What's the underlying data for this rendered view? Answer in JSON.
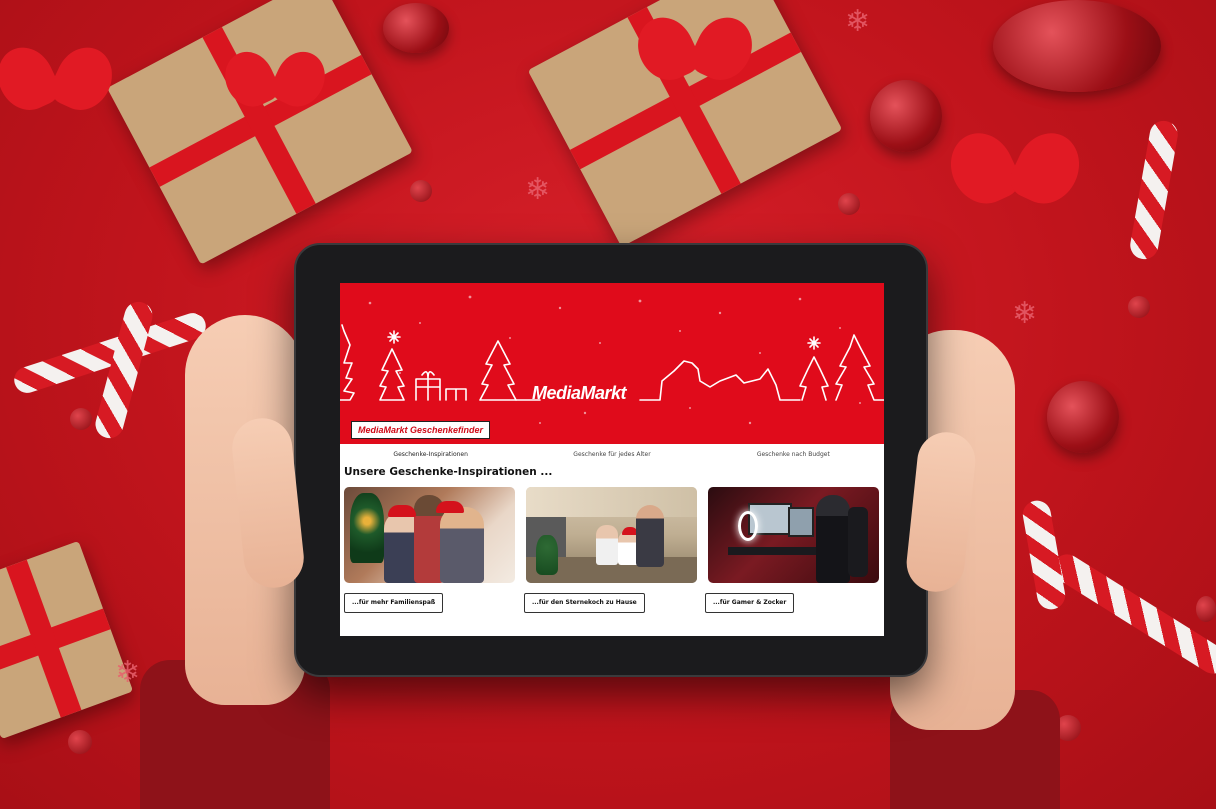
{
  "app": {
    "brand_logo": "MediaMarkt",
    "banner_badge": "MediaMarkt Geschenkefinder"
  },
  "tabs": [
    {
      "label": "Geschenke-Inspirationen",
      "active": true
    },
    {
      "label": "Geschenke für jedes Alter",
      "active": false
    },
    {
      "label": "Geschenke nach Budget",
      "active": false
    }
  ],
  "section": {
    "title": "Unsere Geschenke-Inspirationen ..."
  },
  "cards": [
    {
      "button_label": "...für mehr Familienspaß",
      "image_icon": "family-photo-icon"
    },
    {
      "button_label": "...für den Sternekoch zu Hause",
      "image_icon": "kitchen-photo-icon"
    },
    {
      "button_label": "...für Gamer & Zocker",
      "image_icon": "gamer-photo-icon"
    }
  ],
  "colors": {
    "brand_red": "#e00b1b",
    "background_red": "#c4161c",
    "tablet_bezel": "#1b1b1d"
  }
}
